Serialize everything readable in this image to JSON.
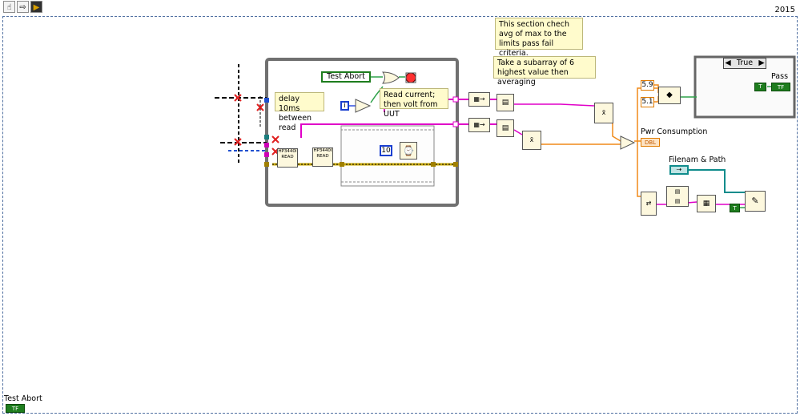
{
  "toolbar": {
    "buttons": [
      {
        "icon": "hand-icon",
        "glyph": "☝"
      },
      {
        "icon": "arrow-icon",
        "glyph": "⇨"
      },
      {
        "icon": "highlight-execution-icon",
        "glyph": "▶"
      }
    ]
  },
  "frame": {
    "label": "2015"
  },
  "comments": {
    "delay": "delay 10ms between read",
    "read_current": "Read current; then volt from UUT",
    "section_check": "This section chech avg of max to the limits pass fail criteria.",
    "subarray": "Take a subarray of 6 highest value then averaging"
  },
  "labels": {
    "pwr_consumption": "Pwr Consumption",
    "filename_path": "Filenam & Path",
    "pass": "Pass",
    "test_abort_bottom": "Test Abort"
  },
  "nodes": {
    "test_abort_local": "Test Abort",
    "case_selector": "True",
    "read_node_1": "HP3440I READ",
    "read_node_2": "HP3440I READ",
    "wait_constant": "10",
    "iteration_constant": "1",
    "limit_high": "5.9",
    "limit_low": "5.1",
    "tf_term": "TF",
    "dbl_term": "DBL",
    "true_const": "T",
    "seq_terminal": "i"
  },
  "colors": {
    "frame_border": "#4f6fa0",
    "wire_pink": "#e000c8",
    "wire_orange": "#f08a18",
    "wire_green": "#2fa24a",
    "wire_teal": "#0f8c8c",
    "wire_blue": "#3050e0",
    "error_wire": "#d8b800",
    "loop_gray": "#707070",
    "note_bg": "#fffbcc"
  }
}
